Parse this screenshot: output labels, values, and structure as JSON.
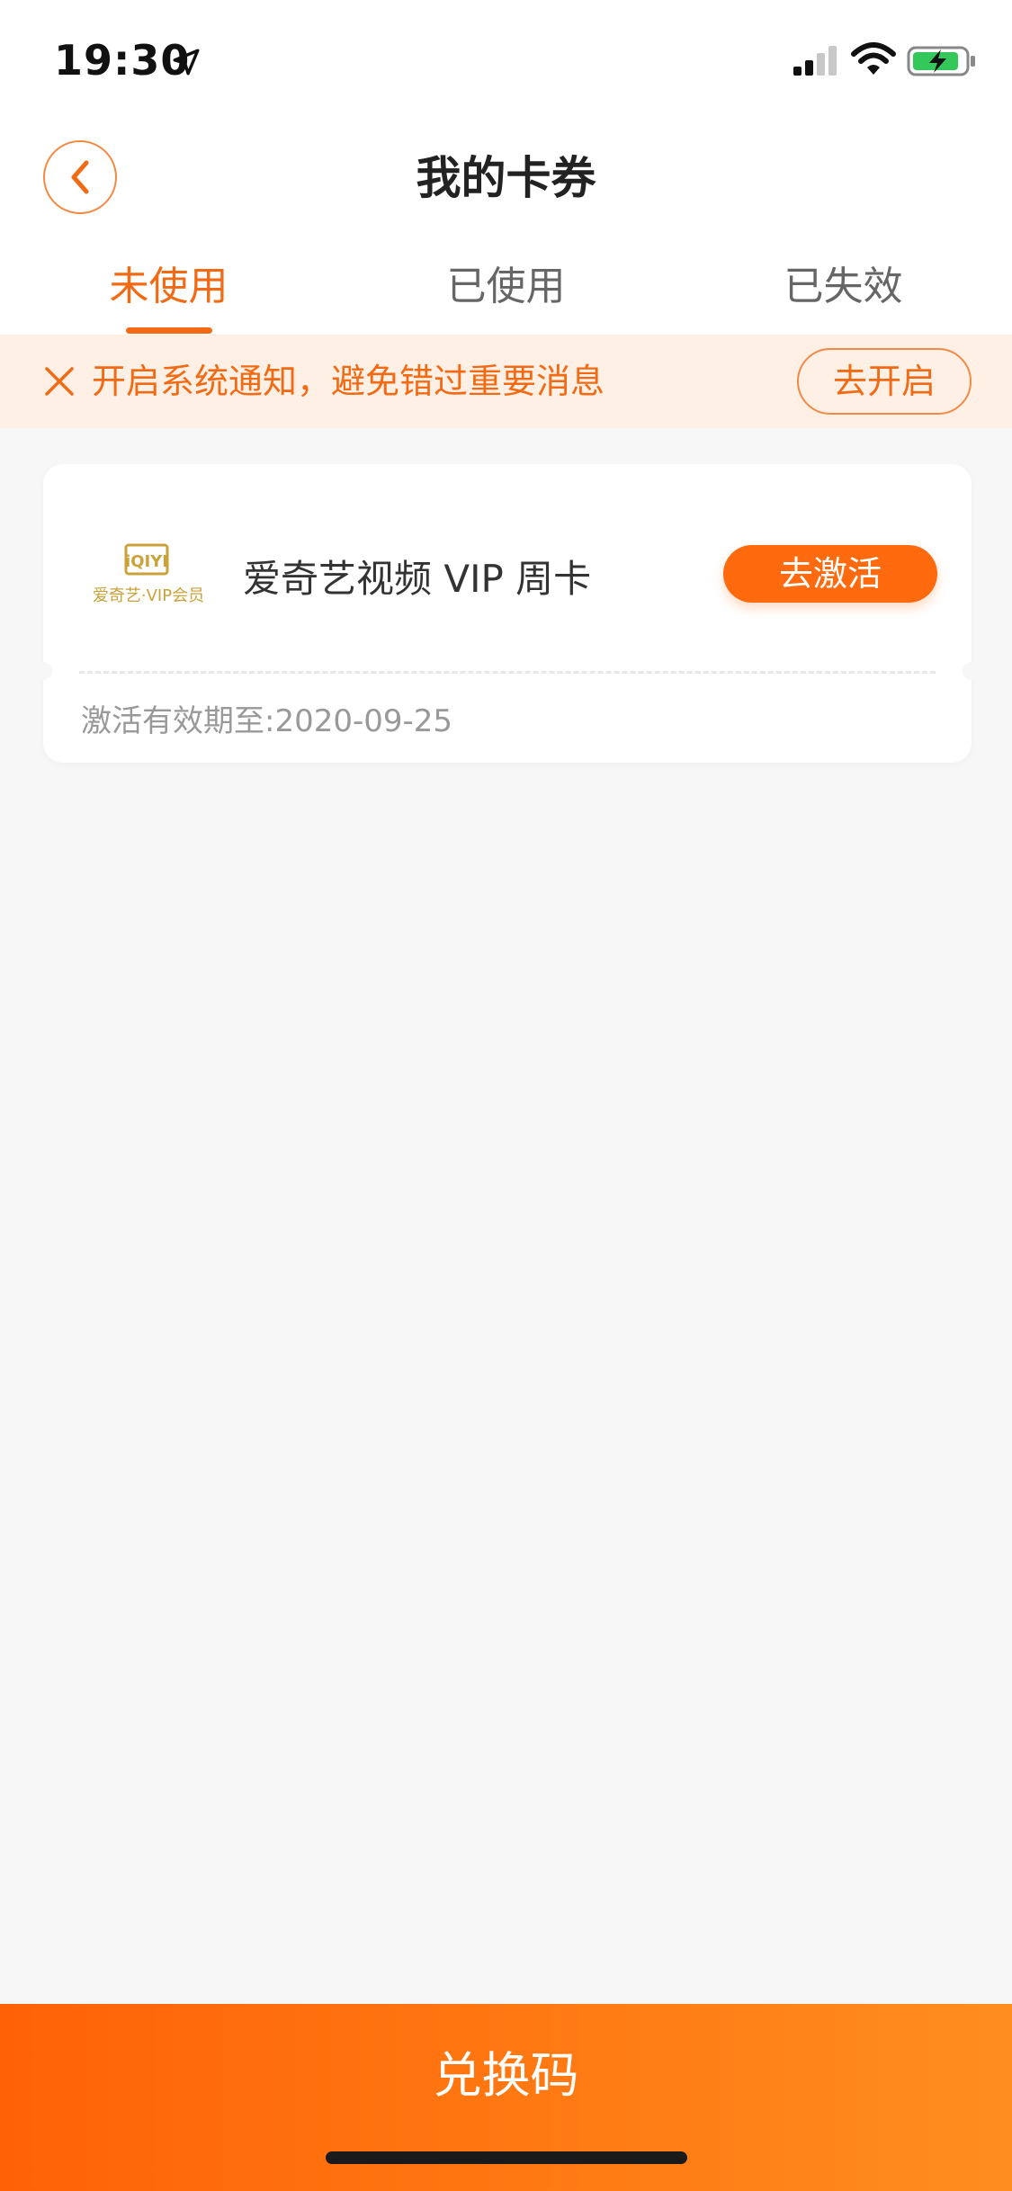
{
  "status_bar": {
    "time": "19:30"
  },
  "header": {
    "title": "我的卡券"
  },
  "tabs": [
    {
      "label": "未使用",
      "active": true
    },
    {
      "label": "已使用",
      "active": false
    },
    {
      "label": "已失效",
      "active": false
    }
  ],
  "notice": {
    "text": "开启系统通知，避免错过重要消息",
    "button_label": "去开启"
  },
  "coupon": {
    "logo_text": "爱奇艺·VIP会员",
    "logo_mark": "iQIYI",
    "title": "爱奇艺视频 VIP 周卡",
    "action_label": "去激活",
    "expiry": "激活有效期至:2020-09-25"
  },
  "bottom": {
    "redeem_label": "兑换码"
  },
  "colors": {
    "accent": "#f26a14",
    "notice_bg": "#fff0e6",
    "gradient_start": "#ff6205",
    "gradient_end": "#ff8d1f",
    "logo_gold": "#c9a23a"
  }
}
